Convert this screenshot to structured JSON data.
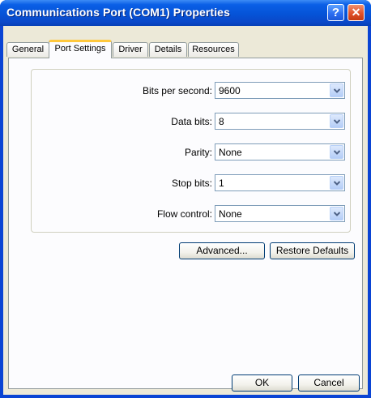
{
  "window": {
    "title": "Communications Port (COM1) Properties"
  },
  "caption_buttons": {
    "help": "?",
    "close": "✕"
  },
  "tabs": [
    {
      "label": "General"
    },
    {
      "label": "Port Settings"
    },
    {
      "label": "Driver"
    },
    {
      "label": "Details"
    },
    {
      "label": "Resources"
    }
  ],
  "active_tab": "Port Settings",
  "settings": [
    {
      "label": "Bits per second:",
      "value": "9600"
    },
    {
      "label": "Data bits:",
      "value": "8"
    },
    {
      "label": "Parity:",
      "value": "None"
    },
    {
      "label": "Stop bits:",
      "value": "1"
    },
    {
      "label": "Flow control:",
      "value": "None"
    }
  ],
  "buttons": {
    "advanced": "Advanced...",
    "restore": "Restore Defaults",
    "ok": "OK",
    "cancel": "Cancel"
  },
  "colors": {
    "titlebar": "#0553d7",
    "dialog_bg": "#ece9d8",
    "tab_accent": "#ffc83c"
  }
}
